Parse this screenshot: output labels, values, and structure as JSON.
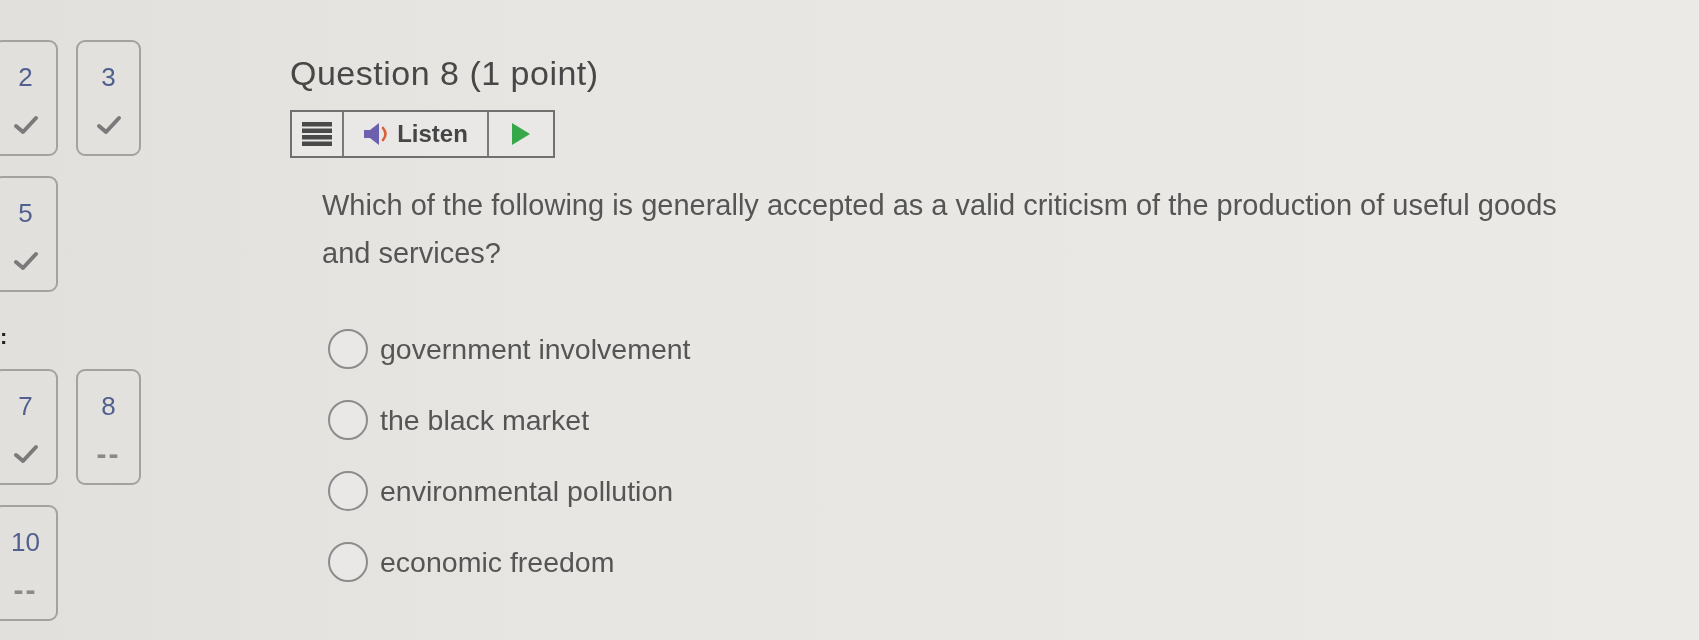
{
  "question_nav": [
    {
      "rows": [
        [
          {
            "number": "2",
            "answered": true
          },
          {
            "number": "3",
            "answered": true
          }
        ],
        [
          {
            "number": "5",
            "answered": true
          }
        ]
      ]
    },
    {
      "label": ":",
      "rows": [
        [
          {
            "number": "7",
            "answered": true
          },
          {
            "number": "8",
            "answered": false,
            "status_text": "--"
          }
        ],
        [
          {
            "number": "10",
            "answered": false,
            "status_text": "--"
          }
        ]
      ]
    }
  ],
  "question": {
    "title": "Question 8 (1 point)",
    "toolbar": {
      "listen_label": "Listen"
    },
    "text": "Which of the following is generally accepted as a valid criticism of the production of useful goods and services?",
    "options": [
      {
        "label": "government involvement",
        "selected": false
      },
      {
        "label": "the black market",
        "selected": false
      },
      {
        "label": "environmental pollution",
        "selected": false
      },
      {
        "label": "economic freedom",
        "selected": false
      }
    ]
  }
}
